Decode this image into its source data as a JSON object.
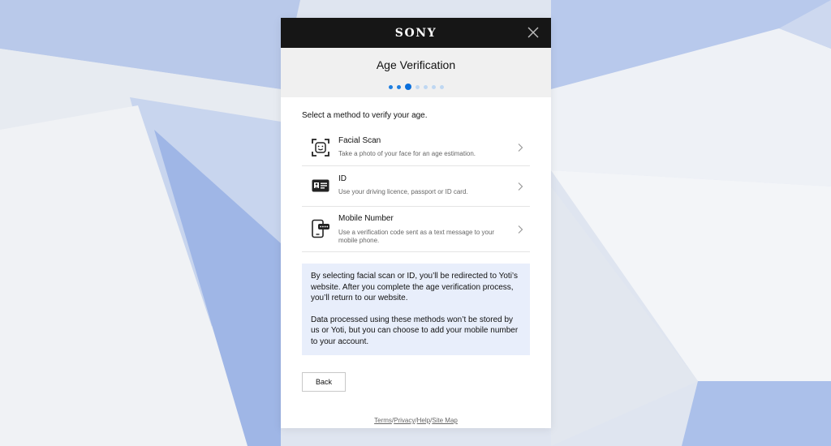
{
  "header": {
    "logo": "SONY",
    "close_icon": "close-icon"
  },
  "title_area": {
    "title": "Age Verification",
    "progress": {
      "total_steps": 7,
      "current_step": 3
    }
  },
  "content": {
    "prompt": "Select a method to verify your age.",
    "methods": [
      {
        "icon": "face-scan-icon",
        "name": "Facial Scan",
        "description": "Take a photo of your face for an age estimation."
      },
      {
        "icon": "id-card-icon",
        "name": "ID",
        "description": "Use your driving licence, passport or ID card."
      },
      {
        "icon": "mobile-phone-icon",
        "name": "Mobile Number",
        "description": "Use a verification code sent as a text message to your mobile phone."
      }
    ],
    "info": {
      "paragraph1": "By selecting facial scan or ID, you’ll be redirected to Yoti’s website. After you complete the age verification process, you’ll return to our website.",
      "paragraph2": "Data processed using these methods won’t be stored by us or Yoti, but you can choose to add your mobile number to your account."
    },
    "back_label": "Back"
  },
  "footer": {
    "links": [
      "Terms",
      "Privacy",
      "Help",
      "Site Map"
    ],
    "separator": "/"
  },
  "colors": {
    "header_bg": "#161616",
    "title_bg": "#f0f0f0",
    "accent": "#0a6fdc",
    "info_bg": "#e8eefb"
  }
}
